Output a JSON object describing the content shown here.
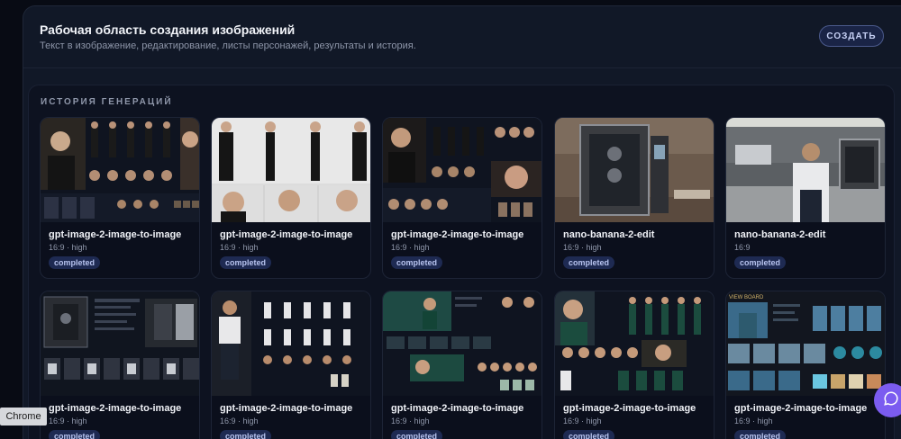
{
  "header": {
    "title": "Рабочая область создания изображений",
    "subtitle": "Текст в изображение, редактирование, листы персонажей, результаты и история.",
    "create_label": "СОЗДАТЬ"
  },
  "history": {
    "label": "ИСТОРИЯ ГЕНЕРАЦИЙ",
    "cards": [
      {
        "title": "gpt-image-2-image-to-image",
        "meta": "16:9 · high",
        "status": "completed"
      },
      {
        "title": "gpt-image-2-image-to-image",
        "meta": "16:9 · high",
        "status": "completed"
      },
      {
        "title": "gpt-image-2-image-to-image",
        "meta": "16:9 · high",
        "status": "completed"
      },
      {
        "title": "nano-banana-2-edit",
        "meta": "16:9 · high",
        "status": "completed"
      },
      {
        "title": "nano-banana-2-edit",
        "meta": "16:9",
        "status": "completed"
      },
      {
        "title": "gpt-image-2-image-to-image",
        "meta": "16:9 · high",
        "status": "completed"
      },
      {
        "title": "gpt-image-2-image-to-image",
        "meta": "16:9 · high",
        "status": "completed"
      },
      {
        "title": "gpt-image-2-image-to-image",
        "meta": "16:9 · high",
        "status": "completed"
      },
      {
        "title": "gpt-image-2-image-to-image",
        "meta": "16:9 · high",
        "status": "completed"
      },
      {
        "title": "gpt-image-2-image-to-image",
        "meta": "16:9 · high",
        "status": "completed"
      }
    ]
  },
  "thumb_caption": "VIEW BOARD",
  "tooltip": "Chrome",
  "icons": {
    "chat": "chat-bubble-icon"
  },
  "colors": {
    "accent": "#7b5cf0",
    "badge_bg": "#1e2a52",
    "badge_text": "#b8c4f0"
  }
}
